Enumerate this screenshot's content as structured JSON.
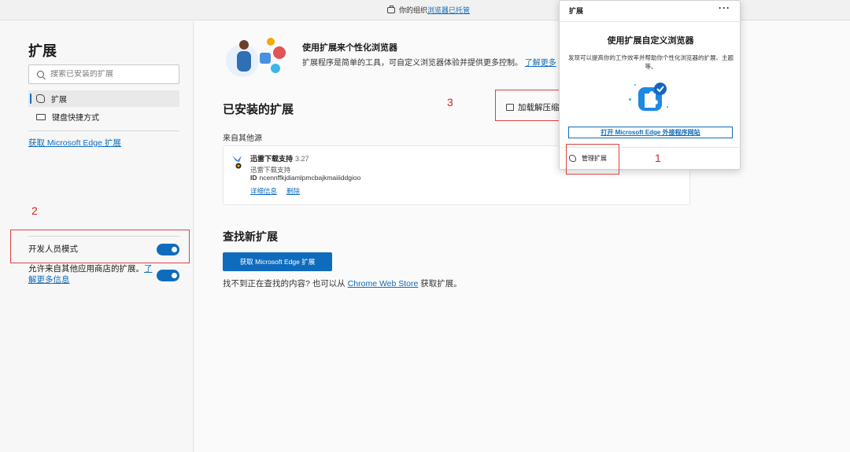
{
  "topbar": {
    "msg_prefix": "你的组织",
    "msg_link": "浏览器已托管"
  },
  "sidebar": {
    "title": "扩展",
    "search_placeholder": "搜索已安装的扩展",
    "items": [
      {
        "label": "扩展",
        "icon": "puzzle-icon",
        "active": true
      },
      {
        "label": "键盘快捷方式",
        "icon": "keyboard-icon",
        "active": false
      }
    ],
    "get_link": "获取 Microsoft Edge 扩展",
    "dev_mode_label": "开发人员模式",
    "dev_mode_on": true,
    "allow_other_stores_text": "允许来自其他应用商店的扩展。",
    "learn_more": "了解更多信息",
    "allow_other_stores_on": true
  },
  "main": {
    "hero_title": "使用扩展来个性化浏览器",
    "hero_desc": "扩展程序是简单的工具，可自定义浏览器体验并提供更多控制。",
    "hero_learn_more": "了解更多",
    "installed_heading": "已安装的扩展",
    "load_unpacked": "加载解压缩",
    "source_heading": "来自其他源",
    "extension": {
      "name": "迅雷下载支持",
      "version": "3.27",
      "description": "迅雷下载支持",
      "id_label": "ID",
      "id_value": "ncennffkjdiamlpmcbajkmaiiiddgioo",
      "details": "详细信息",
      "remove": "删除"
    },
    "find_heading": "查找新扩展",
    "get_button": "获取 Microsoft Edge 扩展",
    "cant_find_prefix": "找不到正在查找的内容? 也可以从",
    "chrome_store": "Chrome Web Store",
    "cant_find_suffix": "获取扩展。"
  },
  "popup": {
    "header": "扩展",
    "more": "···",
    "title": "使用扩展自定义浏览器",
    "description": "发现可以提高你的工作效率并帮助你个性化浏览器的扩展、主题等。",
    "open_site_button": "打开 Microsoft Edge 外接程序网站",
    "manage": "管理扩展"
  },
  "annotations": [
    "1",
    "2",
    "3"
  ],
  "colors": {
    "accent": "#0f6cbd",
    "annotation_red": "#e02020"
  }
}
